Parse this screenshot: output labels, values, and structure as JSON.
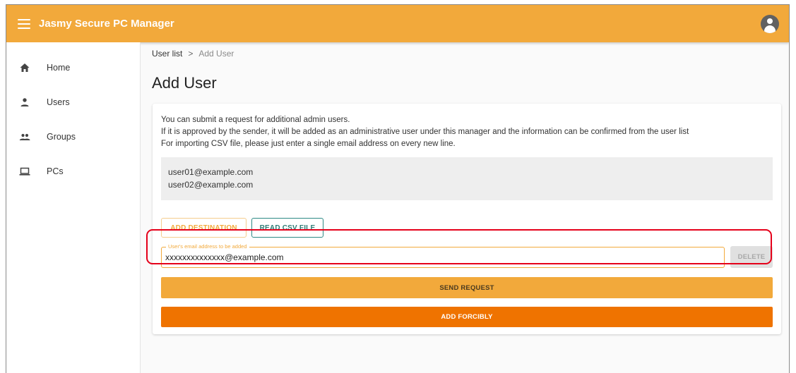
{
  "app": {
    "title": "Jasmy Secure PC Manager"
  },
  "sidebar": {
    "items": [
      {
        "label": "Home",
        "icon": "home-icon"
      },
      {
        "label": "Users",
        "icon": "person-icon"
      },
      {
        "label": "Groups",
        "icon": "group-icon"
      },
      {
        "label": "PCs",
        "icon": "laptop-icon"
      }
    ]
  },
  "breadcrumb": {
    "parent": "User list",
    "separator": ">",
    "current": "Add User"
  },
  "page": {
    "title": "Add User"
  },
  "description": {
    "line1": "You can submit a request for additional admin users.",
    "line2": "If it is approved by the sender, it will be added as an administrative user under this manager and the information can be confirmed from the user list",
    "line3": "For importing CSV file, please just enter a single email address on every new line."
  },
  "email_list": [
    "user01@example.com",
    "user02@example.com"
  ],
  "buttons": {
    "add_destination": "ADD DESTINATION",
    "read_csv": "READ CSV FILE",
    "delete": "DELETE",
    "send_request": "SEND REQUEST",
    "add_forcibly": "ADD FORCIBLY"
  },
  "email_field": {
    "label": "User's email address to be added",
    "value": "xxxxxxxxxxxxxx@example.com"
  },
  "colors": {
    "accent": "#f2a93b",
    "force": "#ef7300",
    "csv": "#2d8a85",
    "highlight": "#e5001a"
  }
}
